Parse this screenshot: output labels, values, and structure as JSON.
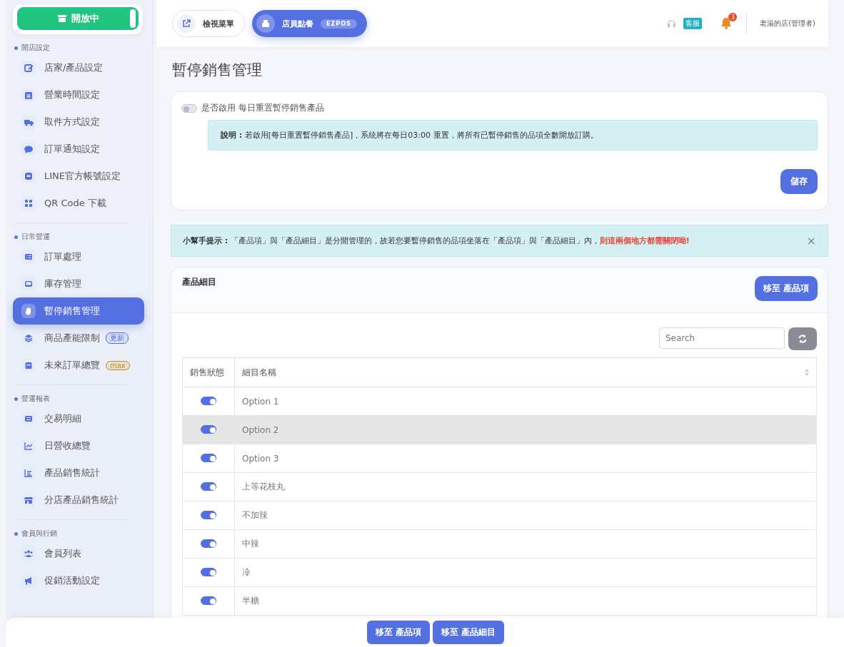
{
  "store_status": {
    "label": "開放中",
    "on": true
  },
  "sidebar": {
    "groups": [
      {
        "label": "開店設定",
        "items": [
          {
            "label": "店家/產品設定",
            "selected": false
          },
          {
            "label": "營業時間設定",
            "selected": false
          },
          {
            "label": "取件方式設定",
            "selected": false
          },
          {
            "label": "訂單通知設定",
            "selected": false
          },
          {
            "label": "LINE官方帳號設定",
            "selected": false
          },
          {
            "label": "QR Code 下載",
            "selected": false
          }
        ]
      },
      {
        "label": "日常營運",
        "items": [
          {
            "label": "訂單處理",
            "selected": false
          },
          {
            "label": "庫存管理",
            "selected": false
          },
          {
            "label": "暫停銷售管理",
            "selected": true
          },
          {
            "label": "商品產能限制",
            "selected": false,
            "badge": "更新",
            "color": "#5470e0"
          },
          {
            "label": "未來訂單總覽",
            "selected": false,
            "badge": "max",
            "color": "#c58a12"
          }
        ]
      },
      {
        "label": "營運報表",
        "items": [
          {
            "label": "交易明細",
            "selected": false
          },
          {
            "label": "日營收總覽",
            "selected": false
          },
          {
            "label": "產品銷售統計",
            "selected": false
          },
          {
            "label": "分店產品銷售統計",
            "selected": false
          }
        ]
      },
      {
        "label": "會員與行銷",
        "items": [
          {
            "label": "會員列表",
            "selected": false
          },
          {
            "label": "促銷活動設定",
            "selected": false
          }
        ]
      }
    ]
  },
  "header": {
    "view_menu": "檢視菜單",
    "staff_order": "店員點餐",
    "staff_badge": "EZPOS",
    "support": "客服",
    "notifications": "3",
    "user": "老湯的店(管理者)"
  },
  "title": "暫停銷售管理",
  "reset_card": {
    "toggle_label": "是否啟用 每日重置暫停銷售產品",
    "on": false,
    "note": "**說明 :** 若啟用[每日重置暫停銷售產品]，系統將在每日03:00 重置，將所有已暫停銷售的品項全數開放訂購。",
    "save": "儲存"
  },
  "tip": {
    "text": "**小幫手提示 :** 「產品項」與「產品細目」是分開管理的，故若您要暫停銷售的品項坐落在「產品項」與「產品細目」內，",
    "warning": "則這兩個地方都需關閉呦!",
    "close": "×"
  },
  "detail_card": {
    "title": "產品細目",
    "move_button": "移至 產品項",
    "search": {
      "placeholder": "Search"
    },
    "columns": [
      "銷售狀態",
      "細目名稱"
    ],
    "rows": [
      {
        "name": "Option 1",
        "on": true,
        "selected": false
      },
      {
        "name": "Option 2",
        "on": true,
        "selected": true
      },
      {
        "name": "Option 3",
        "on": true,
        "selected": false
      },
      {
        "name": "上等花枝丸",
        "on": true,
        "selected": false
      },
      {
        "name": "不加辣",
        "on": true,
        "selected": false
      },
      {
        "name": "中辣",
        "on": true,
        "selected": false
      },
      {
        "name": "冷",
        "on": true,
        "selected": false
      },
      {
        "name": "半糖",
        "on": true,
        "selected": false
      }
    ]
  },
  "footer": {
    "buttons": [
      "移至 產品項",
      "移至 產品細目"
    ]
  }
}
